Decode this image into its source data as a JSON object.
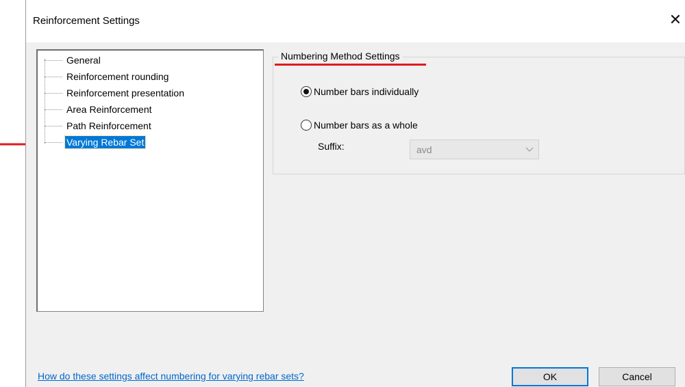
{
  "dialog": {
    "title": "Reinforcement Settings",
    "close_glyph": "✕"
  },
  "tree": {
    "items": [
      {
        "label": "General"
      },
      {
        "label": "Reinforcement rounding"
      },
      {
        "label": "Reinforcement presentation"
      },
      {
        "label": "Area Reinforcement"
      },
      {
        "label": "Path Reinforcement"
      },
      {
        "label": "Varying Rebar Set",
        "selected": true
      }
    ]
  },
  "numbering": {
    "group_title": "Numbering Method Settings",
    "option_individually": "Number bars individually",
    "option_whole": "Number bars as a whole",
    "selected_option": "individually",
    "suffix_label": "Suffix:",
    "suffix_value": "avd"
  },
  "footer": {
    "help_link": "How do these settings affect numbering for varying rebar sets?",
    "ok_label": "OK",
    "cancel_label": "Cancel"
  },
  "colors": {
    "selection": "#0078d7",
    "annotation": "#e0181e",
    "link": "#0066cc"
  }
}
